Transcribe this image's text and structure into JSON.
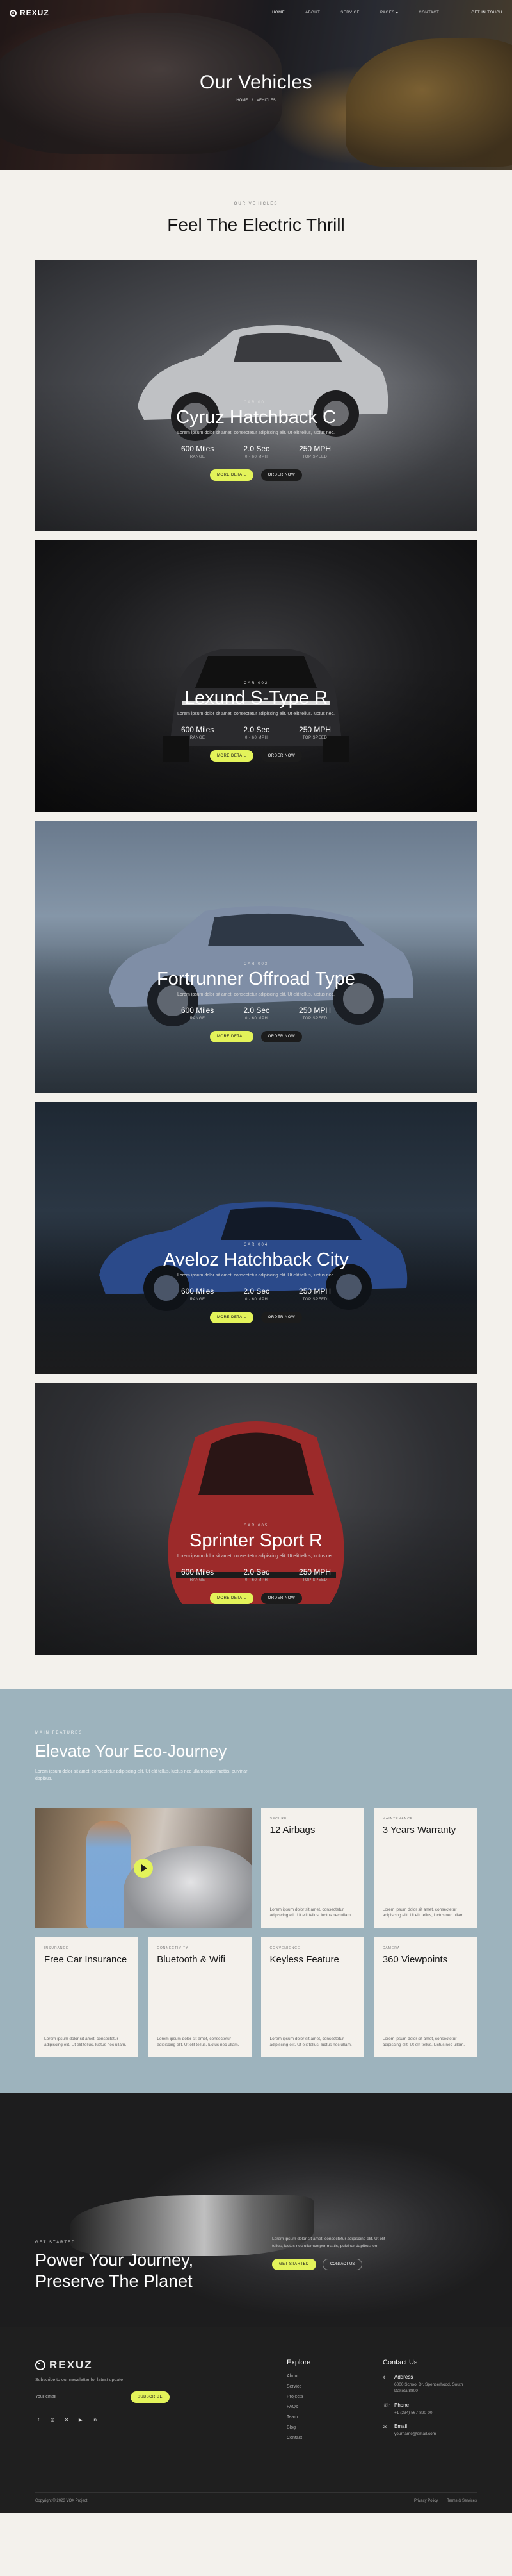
{
  "brand": {
    "name": "REXUZ",
    "footer_name": "REXUZ"
  },
  "nav": {
    "links": [
      {
        "label": "HOME",
        "active": true
      },
      {
        "label": "ABOUT",
        "active": false
      },
      {
        "label": "SERVICE",
        "active": false
      },
      {
        "label": "PAGES",
        "active": false
      },
      {
        "label": "CONTACT",
        "active": false
      }
    ],
    "cta": "GET IN TOUCH"
  },
  "hero": {
    "title": "Our Vehicles",
    "breadcrumb": [
      "HOME",
      "/",
      "VEHICLES"
    ]
  },
  "vehicles": {
    "eyebrow": "OUR VEHICLES",
    "title": "Feel The Electric Thrill",
    "cards": [
      {
        "eyebrow": "CAR 001",
        "title": "Cyruz Hatchback C",
        "desc": "Lorem ipsum dolor sit amet, consectetur adipiscing elit. Ut elit tellus, luctus nec.",
        "stats": [
          {
            "value": "600 Miles",
            "label": "RANGE"
          },
          {
            "value": "2.0 Sec",
            "label": "0 - 60 MPH"
          },
          {
            "value": "250 MPH",
            "label": "TOP SPEED"
          }
        ],
        "btn1": "MORE DETAIL",
        "btn2": "ORDER NOW"
      },
      {
        "eyebrow": "CAR 002",
        "title": "Lexund S-Type R",
        "desc": "Lorem ipsum dolor sit amet, consectetur adipiscing elit. Ut elit tellus, luctus nec.",
        "stats": [
          {
            "value": "600 Miles",
            "label": "RANGE"
          },
          {
            "value": "2.0 Sec",
            "label": "0 - 60 MPH"
          },
          {
            "value": "250 MPH",
            "label": "TOP SPEED"
          }
        ],
        "btn1": "MORE DETAIL",
        "btn2": "ORDER NOW"
      },
      {
        "eyebrow": "CAR 003",
        "title": "Fortrunner Offroad Type",
        "desc": "Lorem ipsum dolor sit amet, consectetur adipiscing elit. Ut elit tellus, luctus nec.",
        "stats": [
          {
            "value": "600 Miles",
            "label": "RANGE"
          },
          {
            "value": "2.0 Sec",
            "label": "0 - 60 MPH"
          },
          {
            "value": "250 MPH",
            "label": "TOP SPEED"
          }
        ],
        "btn1": "MORE DETAIL",
        "btn2": "ORDER NOW"
      },
      {
        "eyebrow": "CAR 004",
        "title": "Aveloz Hatchback City",
        "desc": "Lorem ipsum dolor sit amet, consectetur adipiscing elit. Ut elit tellus, luctus nec.",
        "stats": [
          {
            "value": "600 Miles",
            "label": "RANGE"
          },
          {
            "value": "2.0 Sec",
            "label": "0 - 60 MPH"
          },
          {
            "value": "250 MPH",
            "label": "TOP SPEED"
          }
        ],
        "btn1": "MORE DETAIL",
        "btn2": "ORDER NOW"
      },
      {
        "eyebrow": "CAR 005",
        "title": "Sprinter Sport R",
        "desc": "Lorem ipsum dolor sit amet, consectetur adipiscing elit. Ut elit tellus, luctus nec.",
        "stats": [
          {
            "value": "600 Miles",
            "label": "RANGE"
          },
          {
            "value": "2.0 Sec",
            "label": "0 - 60 MPH"
          },
          {
            "value": "250 MPH",
            "label": "TOP SPEED"
          }
        ],
        "btn1": "MORE DETAIL",
        "btn2": "ORDER NOW"
      }
    ]
  },
  "features": {
    "eyebrow": "MAIN FEATURES",
    "title": "Elevate Your Eco-Journey",
    "desc": "Lorem ipsum dolor sit amet, consectetur adipiscing elit. Ut elit tellus, luctus nec ullamcorper mattis, pulvinar dapibus.",
    "cards": [
      {
        "eyebrow": "SECURE",
        "title": "12 Airbags",
        "desc": "Lorem ipsum dolor sit amet, consectetur adipiscing elit. Ut elit tellus, luctus nec ullam."
      },
      {
        "eyebrow": "MAINTENANCE",
        "title": "3 Years Warranty",
        "desc": "Lorem ipsum dolor sit amet, consectetur adipiscing elit. Ut elit tellus, luctus nec ullam."
      },
      {
        "eyebrow": "INSURANCE",
        "title": "Free Car Insurance",
        "desc": "Lorem ipsum dolor sit amet, consectetur adipiscing elit. Ut elit tellus, luctus nec ullam."
      },
      {
        "eyebrow": "CONNECTIVITY",
        "title": "Bluetooth & Wifi",
        "desc": "Lorem ipsum dolor sit amet, consectetur adipiscing elit. Ut elit tellus, luctus nec ullam."
      },
      {
        "eyebrow": "CONVENIENCE",
        "title": "Keyless Feature",
        "desc": "Lorem ipsum dolor sit amet, consectetur adipiscing elit. Ut elit tellus, luctus nec ullam."
      },
      {
        "eyebrow": "CAMERA",
        "title": "360 Viewpoints",
        "desc": "Lorem ipsum dolor sit amet, consectetur adipiscing elit. Ut elit tellus, luctus nec ullam."
      }
    ]
  },
  "cta": {
    "eyebrow": "GET STARTED",
    "title_line1": "Power Your Journey,",
    "title_line2": "Preserve The Planet",
    "desc": "Lorem ipsum dolor sit amet, consectetur adipiscing elit. Ut elit tellus, luctus nec ullamcorper mattis, pulvinar dapibus leo.",
    "btn1": "GET STARTED",
    "btn2": "CONTACT US"
  },
  "footer": {
    "subscribe_text": "Subscribe to our newsletter for latest update",
    "email_placeholder": "Your email",
    "subscribe_btn": "SUBSCRIBE",
    "explore_title": "Explore",
    "explore_links": [
      "About",
      "Service",
      "Projects",
      "FAQs",
      "Team",
      "Blog",
      "Contact"
    ],
    "contact_title": "Contact Us",
    "address_label": "Address",
    "address_value": "6000 School Dr. Spencerhood, South Dakota 8800",
    "phone_label": "Phone",
    "phone_value": "+1 (234) 567-890-00",
    "email_label": "Email",
    "email_value": "yourname@email.com",
    "copyright": "Copyright © 2023 VOX Project",
    "legal": [
      "Privacy Policy",
      "Terms & Services"
    ]
  }
}
